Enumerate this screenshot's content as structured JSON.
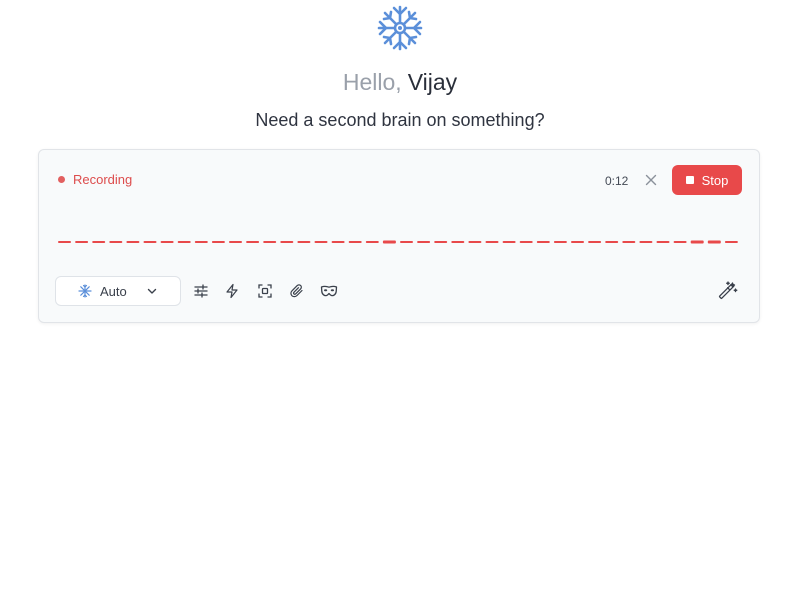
{
  "header": {
    "greeting_prefix": "Hello,",
    "user_name": "Vijay",
    "subtitle": "Need a second brain on something?",
    "logo_icon": "snowflake-brain-logo-icon"
  },
  "recorder": {
    "status_label": "Recording",
    "elapsed": "0:12",
    "stop_label": "Stop",
    "cancel_icon": "close-icon",
    "waveform_color": "#e8494a"
  },
  "toolbar": {
    "model_select": {
      "value": "Auto",
      "icon": "snowflake-icon"
    },
    "tools": [
      {
        "name": "sliders-icon"
      },
      {
        "name": "lightning-icon"
      },
      {
        "name": "screenshot-icon"
      },
      {
        "name": "paperclip-icon"
      },
      {
        "name": "mask-icon"
      }
    ],
    "magic_icon": "magic-wand-icon"
  },
  "colors": {
    "accent": "#5b8fd9",
    "recording": "#e8494a",
    "muted_text": "#9aa0aa"
  }
}
